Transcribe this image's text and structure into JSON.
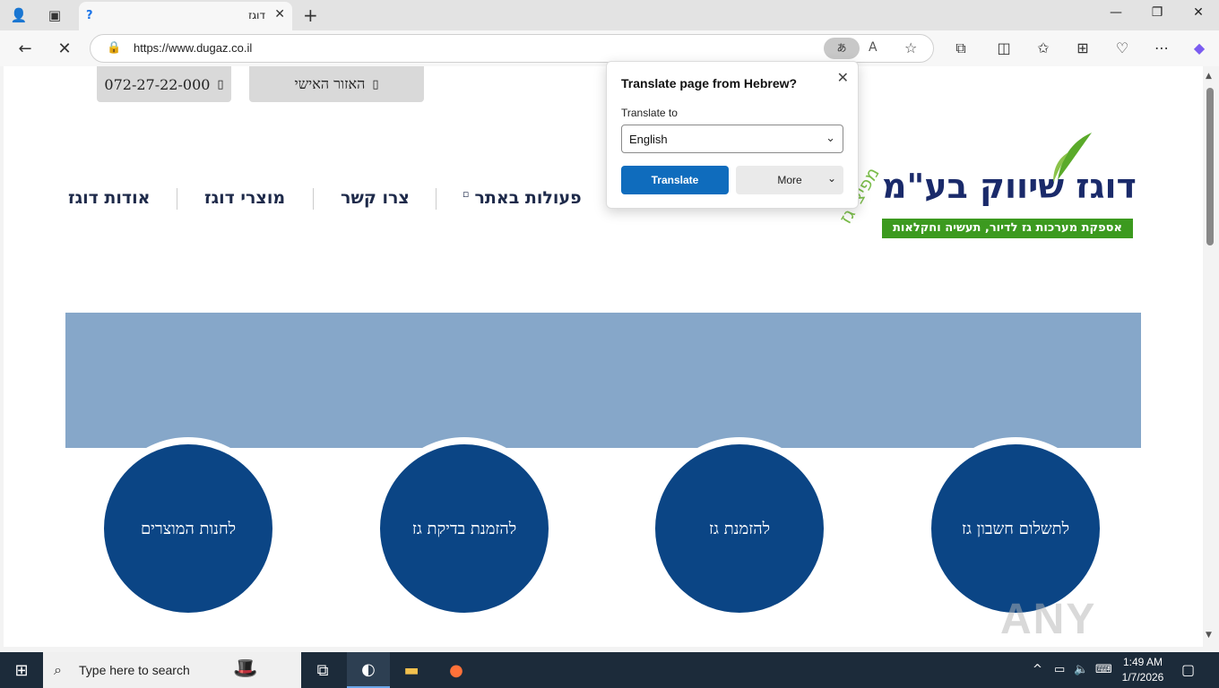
{
  "browser": {
    "tab_title": "דוגז",
    "tab_favicon": "?",
    "url": "https://www.dugaz.co.il",
    "translate_icon_label": "あ",
    "read_aloud_label": "A",
    "new_tab": "+",
    "accent": "#0f6cbd"
  },
  "page": {
    "phone": "072-27-22-000",
    "phone_icon": "▯",
    "personal_area": "האזור האישי",
    "personal_icon": "▯",
    "menu": {
      "actions": "פעולות באתר",
      "actions_icon": "▫",
      "contact": "צרו קשר",
      "products": "מוצרי דוגז",
      "about": "אודות דוגז"
    },
    "logo": {
      "main": "דוגז שיווק בע\"מ",
      "tagline": "אספקת מערכות גז לדיור, תעשיה וחקלאות",
      "arc_text": "מפיצי גז"
    },
    "circles": [
      "לחנות המוצרים",
      "להזמנת בדיקת גז",
      "להזמנת גז",
      "לתשלום חשבון גז"
    ],
    "watermark": "ANY RUN",
    "banner_color": "#86a7c9",
    "circle_color": "#0b4585"
  },
  "translate_popup": {
    "title": "Translate page from Hebrew?",
    "label": "Translate to",
    "selected_language": "English",
    "translate_button": "Translate",
    "more_button": "More"
  },
  "taskbar": {
    "search_placeholder": "Type here to search",
    "time": "1:49 AM",
    "date": "1/7/2026"
  }
}
